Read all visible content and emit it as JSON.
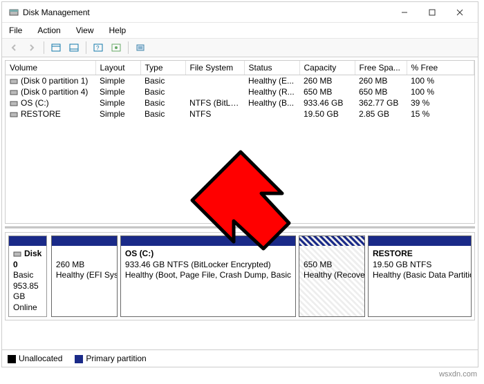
{
  "window": {
    "title": "Disk Management"
  },
  "menu": {
    "file": "File",
    "action": "Action",
    "view": "View",
    "help": "Help"
  },
  "columns": {
    "volume": "Volume",
    "layout": "Layout",
    "type": "Type",
    "fs": "File System",
    "status": "Status",
    "capacity": "Capacity",
    "free": "Free Spa...",
    "pfree": "% Free"
  },
  "rows": [
    {
      "volume": "(Disk 0 partition 1)",
      "layout": "Simple",
      "type": "Basic",
      "fs": "",
      "status": "Healthy (E...",
      "capacity": "260 MB",
      "free": "260 MB",
      "pfree": "100 %"
    },
    {
      "volume": "(Disk 0 partition 4)",
      "layout": "Simple",
      "type": "Basic",
      "fs": "",
      "status": "Healthy (R...",
      "capacity": "650 MB",
      "free": "650 MB",
      "pfree": "100 %"
    },
    {
      "volume": "OS (C:)",
      "layout": "Simple",
      "type": "Basic",
      "fs": "NTFS (BitLo...",
      "status": "Healthy (B...",
      "capacity": "933.46 GB",
      "free": "362.77 GB",
      "pfree": "39 %"
    },
    {
      "volume": "RESTORE",
      "layout": "Simple",
      "type": "Basic",
      "fs": "NTFS",
      "status": "",
      "capacity": "19.50 GB",
      "free": "2.85 GB",
      "pfree": "15 %"
    }
  ],
  "disk": {
    "name": "Disk 0",
    "type": "Basic",
    "size": "953.85 GB",
    "state": "Online"
  },
  "parts": [
    {
      "title": "",
      "line1": "260 MB",
      "line2": "Healthy (EFI Sys"
    },
    {
      "title": "OS  (C:)",
      "line1": "933.46 GB NTFS (BitLocker Encrypted)",
      "line2": "Healthy (Boot, Page File, Crash Dump, Basic"
    },
    {
      "title": "",
      "line1": "650 MB",
      "line2": "Healthy (Recovery"
    },
    {
      "title": "RESTORE",
      "line1": "19.50 GB NTFS",
      "line2": "Healthy (Basic Data Partition)"
    }
  ],
  "legend": {
    "unallocated": "Unallocated",
    "primary": "Primary partition"
  },
  "watermark": "wsxdn.com"
}
